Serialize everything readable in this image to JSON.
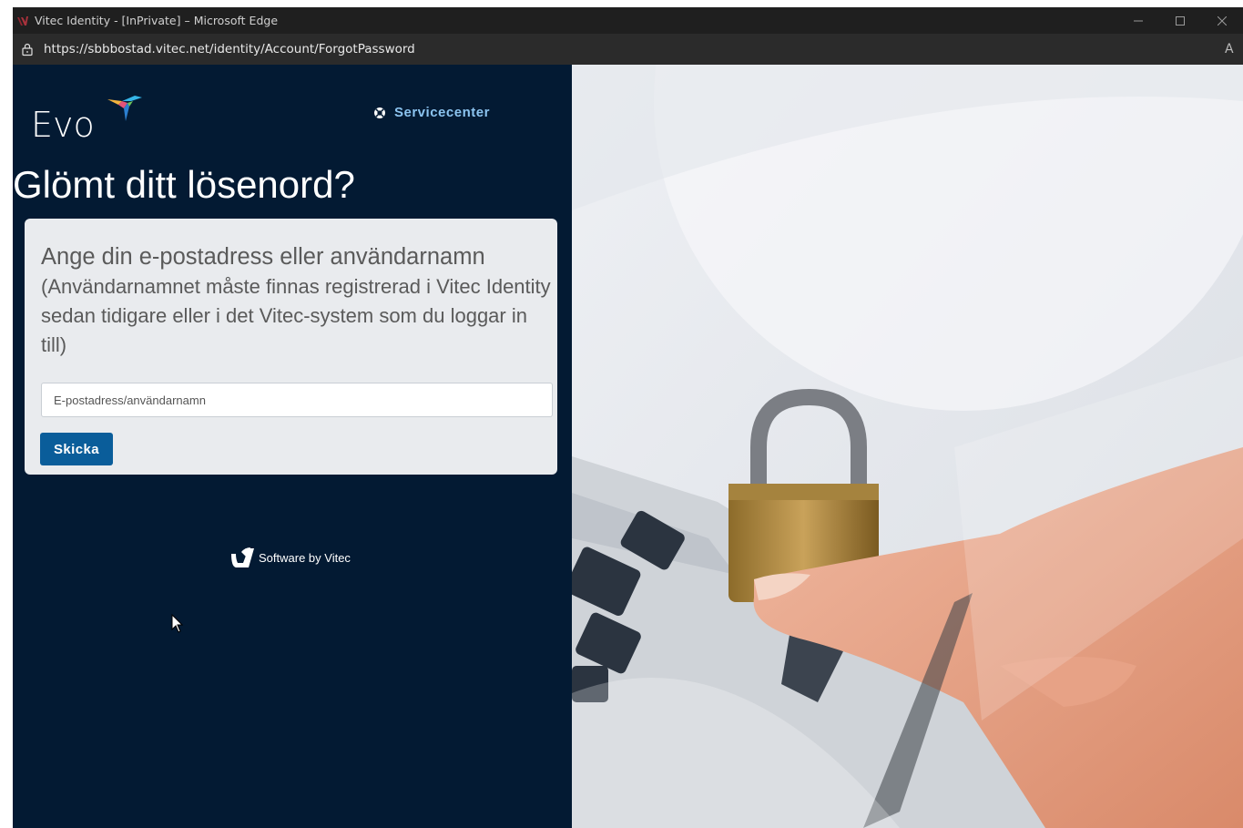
{
  "browser": {
    "window_title": "Vitec Identity - [InPrivate] – Microsoft Edge",
    "url": "https://sbbbostad.vitec.net/identity/Account/ForgotPassword",
    "read_aloud": "A"
  },
  "header": {
    "logo_text": "Evo",
    "servicecenter_label": "Servicecenter"
  },
  "page": {
    "title": "Glömt ditt lösenord?"
  },
  "form": {
    "instruction_main": "Ange din e-postadress eller användarnamn",
    "instruction_sub": "(Användarnamnet måste finnas registrerad i Vitec Identity sedan tidigare eller i det Vitec-system som du loggar in till)",
    "username_placeholder": "E-postadress/användarnamn",
    "username_value": "",
    "submit_label": "Skicka"
  },
  "footer": {
    "brand_text": "Software by Vitec"
  },
  "colors": {
    "panel_bg": "#031a33",
    "card_bg": "#e9ebee",
    "button_bg": "#0a5d9a",
    "link": "#8cc4f0"
  }
}
